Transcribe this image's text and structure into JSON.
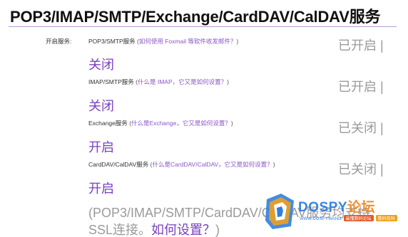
{
  "page_title": "POP3/IMAP/SMTP/Exchange/CardDAV/CalDAV服务",
  "field_label": "开启服务:",
  "services": [
    {
      "name": "POP3/SMTP服务",
      "paren_open": "(",
      "help_link": "如何使用 Foxmail 等软件收发邮件？",
      "paren_close": ")",
      "status": "已开启 |",
      "action": "关闭"
    },
    {
      "name": "IMAP/SMTP服务",
      "paren_open": "(",
      "help_link": "什么是 IMAP，它又是如何设置？",
      "paren_close": ")",
      "status": "已开启 |",
      "action": "关闭"
    },
    {
      "name": "Exchange服务",
      "paren_open": "(",
      "help_link": "什么是Exchange，它又是如何设置？",
      "paren_close": ")",
      "status": "已关闭 |",
      "action": "开启"
    },
    {
      "name": "CardDAV/CalDAV服务",
      "paren_open": "(",
      "help_link": "什么是CardDAV/CalDAV，它又是如何设置？",
      "paren_close": ")",
      "status": "已关闭 |",
      "action": "开启"
    }
  ],
  "ssl_note": {
    "line1": "(POP3/IMAP/SMTP/CardDAV/CalDAV服务均支持",
    "line2_prefix": "SSL连接。",
    "line2_link": "如何设置？",
    "line2_suffix": ")"
  },
  "watermark": {
    "name_latin": "DOSPY",
    "name_cn": "论坛",
    "url": "WWW.DOSPY.WANG",
    "badge1": "最懂数码论坛",
    "badge2": "数码百科"
  },
  "colors": {
    "accent_purple": "#7a3fbf",
    "status_gray": "#9a9a9a",
    "rule": "#b79ad8"
  }
}
